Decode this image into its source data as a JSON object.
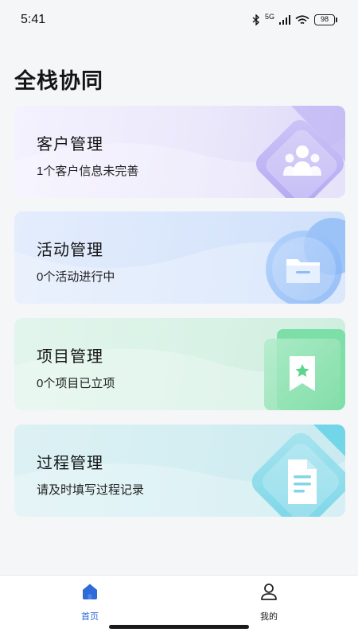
{
  "status_bar": {
    "time": "5:41",
    "network": "5G",
    "battery": "98"
  },
  "page": {
    "title": "全栈协同"
  },
  "cards": [
    {
      "title": "客户管理",
      "subtitle": "1个客户信息未完善",
      "icon": "team-icon"
    },
    {
      "title": "活动管理",
      "subtitle": "0个活动进行中",
      "icon": "folder-icon"
    },
    {
      "title": "项目管理",
      "subtitle": "0个项目已立项",
      "icon": "bookmark-star-icon"
    },
    {
      "title": "过程管理",
      "subtitle": "请及时填写过程记录",
      "icon": "document-icon"
    }
  ],
  "tab_bar": {
    "items": [
      {
        "label": "首页",
        "icon": "home-icon",
        "active": true
      },
      {
        "label": "我的",
        "icon": "user-icon",
        "active": false
      }
    ]
  },
  "colors": {
    "accent": "#2f6bd8",
    "background": "#f5f6f8"
  }
}
